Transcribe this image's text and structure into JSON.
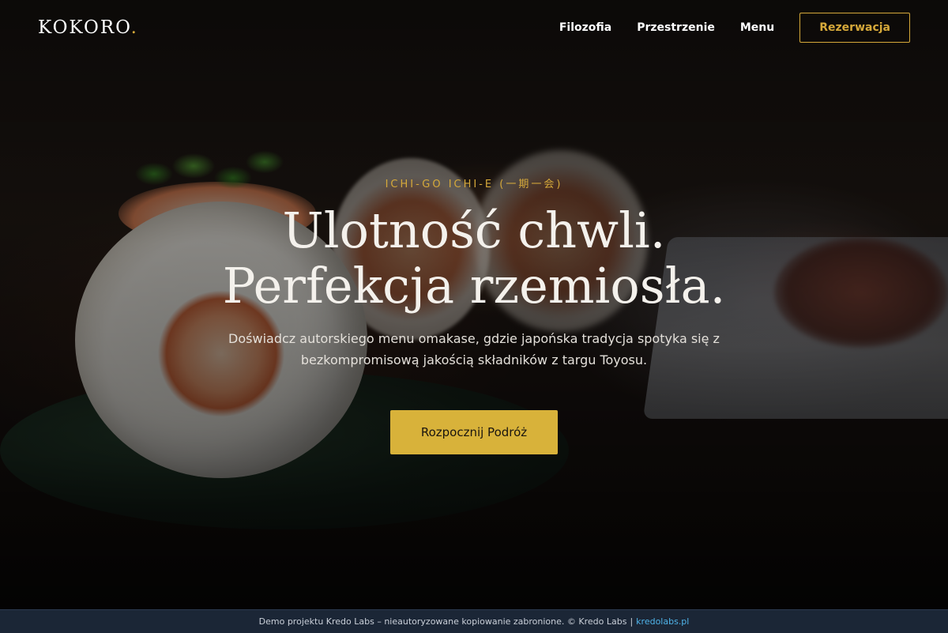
{
  "brand": {
    "name": "KOKORO",
    "dot": ".",
    "accent_color": "#d6a93a"
  },
  "nav": {
    "items": [
      {
        "label": "Filozofia"
      },
      {
        "label": "Przestrzenie"
      },
      {
        "label": "Menu"
      }
    ],
    "reserve_label": "Rezerwacja"
  },
  "hero": {
    "eyebrow": "ICHI-GO ICHI-E (一期一会)",
    "headline_line1": "Ulotność chwli.",
    "headline_line2": "Perfekcja rzemiosła.",
    "lead_line1": "Doświadcz autorskiego menu omakase, gdzie japońska tradycja spotyka się z",
    "lead_line2": "bezkompromisową jakością składników z targu Toyosu.",
    "cta_label": "Rozpocznij Podróż",
    "cta_color": "#d8b23a"
  },
  "footer": {
    "text": "Demo projektu Kredo Labs – nieautoryzowane kopiowanie zabronione. © Kredo Labs",
    "separator": "|",
    "link_label": "kredolabs.pl",
    "link_color": "#4fb3e8"
  }
}
